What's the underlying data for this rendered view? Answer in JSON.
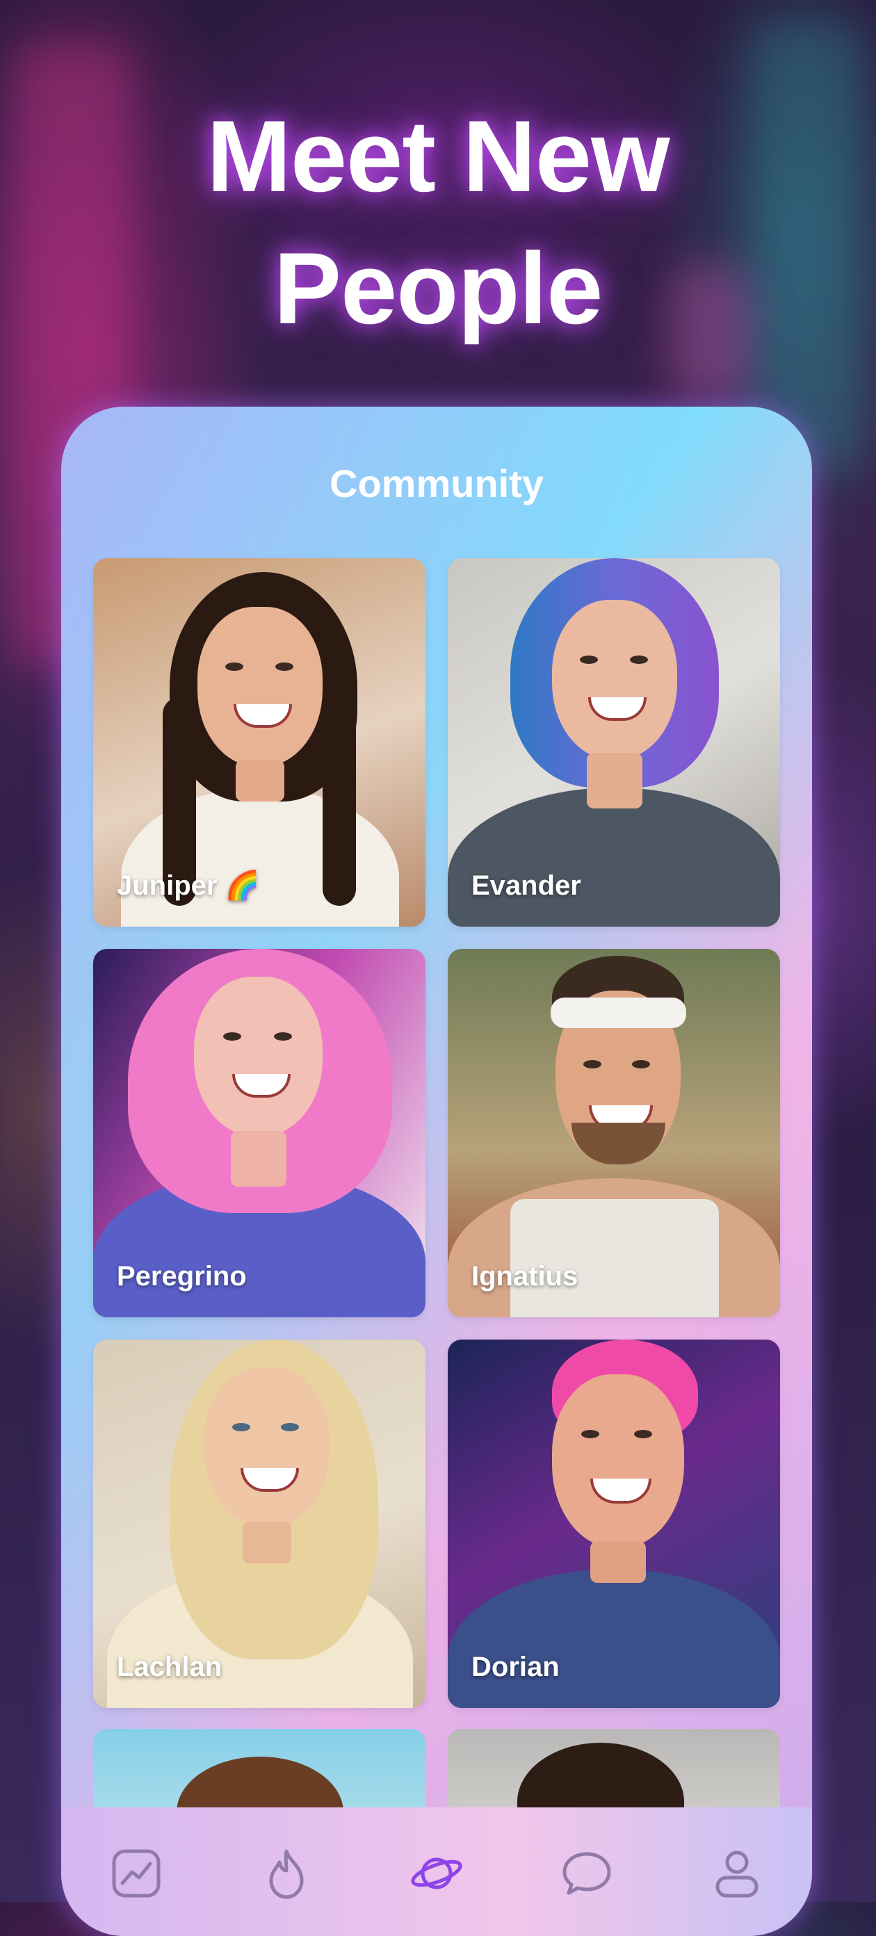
{
  "headline": {
    "line1": "Meet New",
    "line2": "People"
  },
  "community": {
    "title": "Community",
    "profiles": [
      {
        "name": "Juniper 🌈"
      },
      {
        "name": "Evander"
      },
      {
        "name": "Peregrino"
      },
      {
        "name": "Ignatius"
      },
      {
        "name": "Lachlan"
      },
      {
        "name": "Dorian"
      }
    ]
  },
  "tabbar": {
    "items": [
      {
        "icon": "chart-icon",
        "active": false
      },
      {
        "icon": "flame-icon",
        "active": false
      },
      {
        "icon": "planet-icon",
        "active": true
      },
      {
        "icon": "chat-bubble-icon",
        "active": false
      },
      {
        "icon": "profile-icon",
        "active": false
      }
    ],
    "active_color": "#8e44e8",
    "inactive_color": "#8f7aa8"
  }
}
